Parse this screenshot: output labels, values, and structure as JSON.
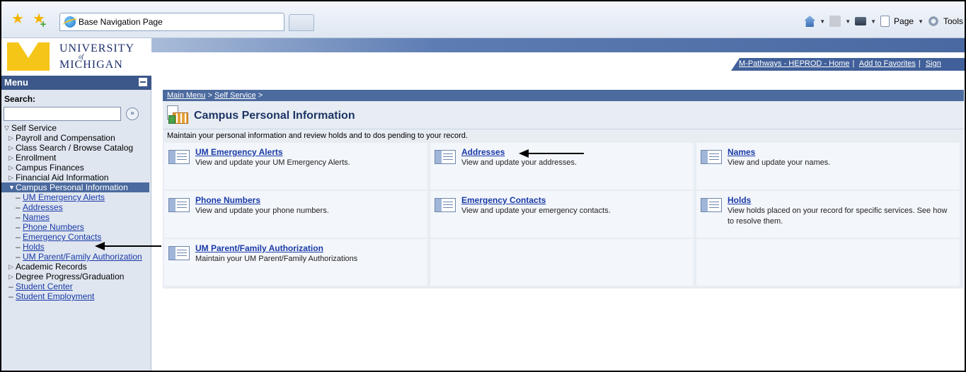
{
  "browser": {
    "tab_title": "Base Navigation Page",
    "cmd_page": "Page",
    "cmd_tools": "Tools"
  },
  "logo": {
    "line1": "UNIVERSITY",
    "line2": "of",
    "line3": "MICHIGAN"
  },
  "header_links": {
    "home": "M-Pathways - HEPROD - Home",
    "favorites": "Add to Favorites",
    "sign": "Sign"
  },
  "menu": {
    "title": "Menu",
    "search_label": "Search:",
    "search_value": "",
    "root": "Self Service",
    "items": [
      {
        "label": "Payroll and Compensation"
      },
      {
        "label": "Class Search / Browse Catalog"
      },
      {
        "label": "Enrollment"
      },
      {
        "label": "Campus Finances"
      },
      {
        "label": "Financial Aid Information"
      },
      {
        "label": "Campus Personal Information"
      },
      {
        "label": "Academic Records"
      },
      {
        "label": "Degree Progress/Graduation"
      },
      {
        "label": "Student Center"
      },
      {
        "label": "Student Employment"
      }
    ],
    "subitems": [
      {
        "label": "UM Emergency Alerts"
      },
      {
        "label": "Addresses"
      },
      {
        "label": "Names"
      },
      {
        "label": "Phone Numbers"
      },
      {
        "label": "Emergency Contacts"
      },
      {
        "label": "Holds"
      },
      {
        "label": "UM Parent/Family Authorization"
      }
    ]
  },
  "breadcrumb": {
    "main_menu": "Main Menu",
    "self_service": "Self Service",
    "separator": ">"
  },
  "page": {
    "title": "Campus Personal Information",
    "description": "Maintain your personal information and review holds and to dos pending to your record."
  },
  "cards": [
    {
      "title": "UM Emergency Alerts",
      "desc": "View and update your UM Emergency Alerts."
    },
    {
      "title": "Addresses",
      "desc": "View and update your addresses."
    },
    {
      "title": "Names",
      "desc": "View and update your names."
    },
    {
      "title": "Phone Numbers",
      "desc": "View and update your phone numbers."
    },
    {
      "title": "Emergency Contacts",
      "desc": "View and update your emergency contacts."
    },
    {
      "title": "Holds",
      "desc": "View holds placed on your record for specific services. See how to resolve them."
    },
    {
      "title": "UM Parent/Family Authorization",
      "desc": "Maintain your UM Parent/Family Authorizations"
    }
  ]
}
